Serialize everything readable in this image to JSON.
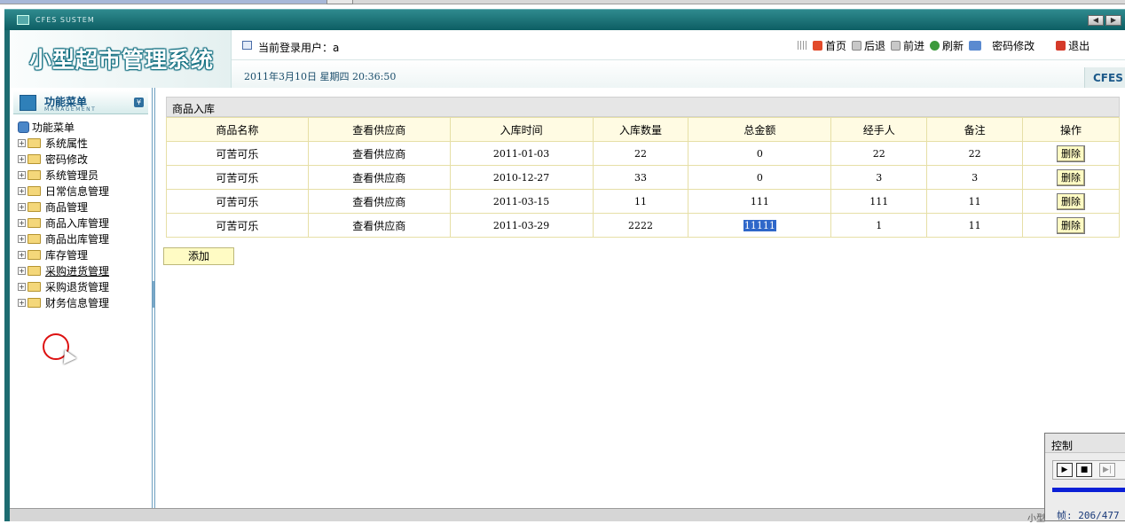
{
  "window": {
    "title": "CFES SUSTEM"
  },
  "header": {
    "system_title": "小型超市管理系统",
    "current_user_label": "当前登录用户：a",
    "datetime": "2011年3月10日  星期四  20:36:50",
    "brand_tag": "CFES",
    "toolbar": {
      "home": "首页",
      "back": "后退",
      "forward": "前进",
      "refresh": "刷新",
      "change_password": "密码修改",
      "logout": "退出"
    }
  },
  "sidebar": {
    "title": "功能菜单",
    "subtitle": "MANAGEMENT",
    "root": "功能菜单",
    "items": [
      {
        "label": "系统属性"
      },
      {
        "label": "密码修改"
      },
      {
        "label": "系统管理员"
      },
      {
        "label": "日常信息管理"
      },
      {
        "label": "商品管理"
      },
      {
        "label": "商品入库管理"
      },
      {
        "label": "商品出库管理"
      },
      {
        "label": "库存管理"
      },
      {
        "label": "采购进货管理"
      },
      {
        "label": "采购退货管理"
      },
      {
        "label": "财务信息管理"
      }
    ]
  },
  "main": {
    "panel_title": "商品入库",
    "columns": [
      "商品名称",
      "查看供应商",
      "入库时间",
      "入库数量",
      "总金额",
      "经手人",
      "备注",
      "操作"
    ],
    "rows": [
      {
        "name": "可苦可乐",
        "supplier": "查看供应商",
        "date": "2011-01-03",
        "qty": "22",
        "amount": "0",
        "handler": "22",
        "note": "22",
        "action": "删除"
      },
      {
        "name": "可苦可乐",
        "supplier": "查看供应商",
        "date": "2010-12-27",
        "qty": "33",
        "amount": "0",
        "handler": "3",
        "note": "3",
        "action": "删除"
      },
      {
        "name": "可苦可乐",
        "supplier": "查看供应商",
        "date": "2011-03-15",
        "qty": "11",
        "amount": "111",
        "handler": "111",
        "note": "11",
        "action": "删除"
      },
      {
        "name": "可苦可乐",
        "supplier": "查看供应商",
        "date": "2011-03-29",
        "qty": "2222",
        "amount": "11111",
        "handler": "1",
        "note": "11",
        "action": "删除"
      }
    ],
    "add_label": "添加"
  },
  "statusbar": {
    "text": "小型"
  },
  "control_panel": {
    "title": "控制",
    "frame_label": "帧: 206/477"
  },
  "colors": {
    "titlebar": "#0d5e63",
    "table_header": "#fffbe3",
    "button_fill": "#fffbc4",
    "selection": "#2f67c9"
  }
}
